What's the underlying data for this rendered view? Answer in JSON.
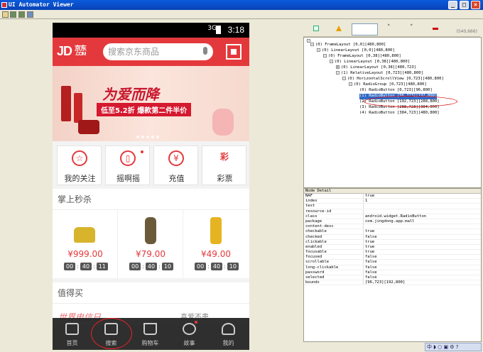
{
  "window": {
    "title": "UI Automator Viewer",
    "min": "_",
    "max": "□",
    "close": "×"
  },
  "phone": {
    "status": {
      "time": "3:18",
      "signal": "3G"
    },
    "header": {
      "logo": "JD",
      "logo_cn": "京东",
      "logo_com": ".COM",
      "search_placeholder": "搜索京东商品"
    },
    "banner": {
      "headline": "为爱而降",
      "sub": "低至5.2折  爆款第二件半价"
    },
    "quick": [
      {
        "label": "我的关注",
        "icon": "☆"
      },
      {
        "label": "摇啊摇",
        "icon": "▯"
      },
      {
        "label": "充值",
        "icon": "¥"
      },
      {
        "label": "彩票",
        "icon": "彩"
      }
    ],
    "flash_title": "掌上秒杀",
    "deals": [
      {
        "price": "¥999.00",
        "timer": [
          "00",
          "40",
          "11"
        ]
      },
      {
        "price": "¥79.00",
        "timer": [
          "00",
          "40",
          "10"
        ]
      },
      {
        "price": "¥49.00",
        "timer": [
          "00",
          "40",
          "10"
        ]
      }
    ],
    "worth_title": "值得买",
    "worth_a": "世界电信日",
    "worth_b": "喜爱不患",
    "nav": [
      {
        "label": "首页"
      },
      {
        "label": "搜索"
      },
      {
        "label": "购物车"
      },
      {
        "label": "故事"
      },
      {
        "label": "我的"
      }
    ]
  },
  "tree": {
    "coords": "(540,666)",
    "nodes": [
      {
        "text": "(0) FrameLayout [0,0][480,800]"
      },
      {
        "text": "(0) LinearLayout [0,0][480,800]"
      },
      {
        "text": "(0) FrameLayout [0,38][480,800]"
      },
      {
        "text": "(0) LinearLayout [0,38][480,800]"
      },
      {
        "text": "(0) LinearLayout [0,38][480,723]"
      },
      {
        "text": "(1) RelativeLayout [0,723][480,800]"
      },
      {
        "text": "(0) HorizontalScrollView [0,723][480,800]"
      },
      {
        "text": "(0) RadioGroup [0,723][480,800]"
      },
      {
        "text": "(0) RadioButton [0,723][96,800]"
      },
      {
        "text": "(1) RadioButton [96,723][192,800]"
      },
      {
        "text": "(2) RadioButton [192,723][288,800]"
      },
      {
        "text": "(3) RadioButton [288,723][384,800]"
      },
      {
        "text": "(4) RadioButton [384,723][480,800]"
      }
    ]
  },
  "detail": {
    "header": "Node Detail",
    "rows": [
      {
        "k": "NAF",
        "v": "true"
      },
      {
        "k": "index",
        "v": "1"
      },
      {
        "k": "text",
        "v": ""
      },
      {
        "k": "resource-id",
        "v": ""
      },
      {
        "k": "class",
        "v": "android.widget.RadioButton"
      },
      {
        "k": "package",
        "v": "com.jingdong.app.mall"
      },
      {
        "k": "content-desc",
        "v": ""
      },
      {
        "k": "checkable",
        "v": "true"
      },
      {
        "k": "checked",
        "v": "false"
      },
      {
        "k": "clickable",
        "v": "true"
      },
      {
        "k": "enabled",
        "v": "true"
      },
      {
        "k": "focusable",
        "v": "true"
      },
      {
        "k": "focused",
        "v": "false"
      },
      {
        "k": "scrollable",
        "v": "false"
      },
      {
        "k": "long-clickable",
        "v": "false"
      },
      {
        "k": "password",
        "v": "false"
      },
      {
        "k": "selected",
        "v": "false"
      },
      {
        "k": "bounds",
        "v": "[96,723][192,800]"
      }
    ]
  },
  "tray": "中 ◗ ○ ▣ ⚙ ?"
}
